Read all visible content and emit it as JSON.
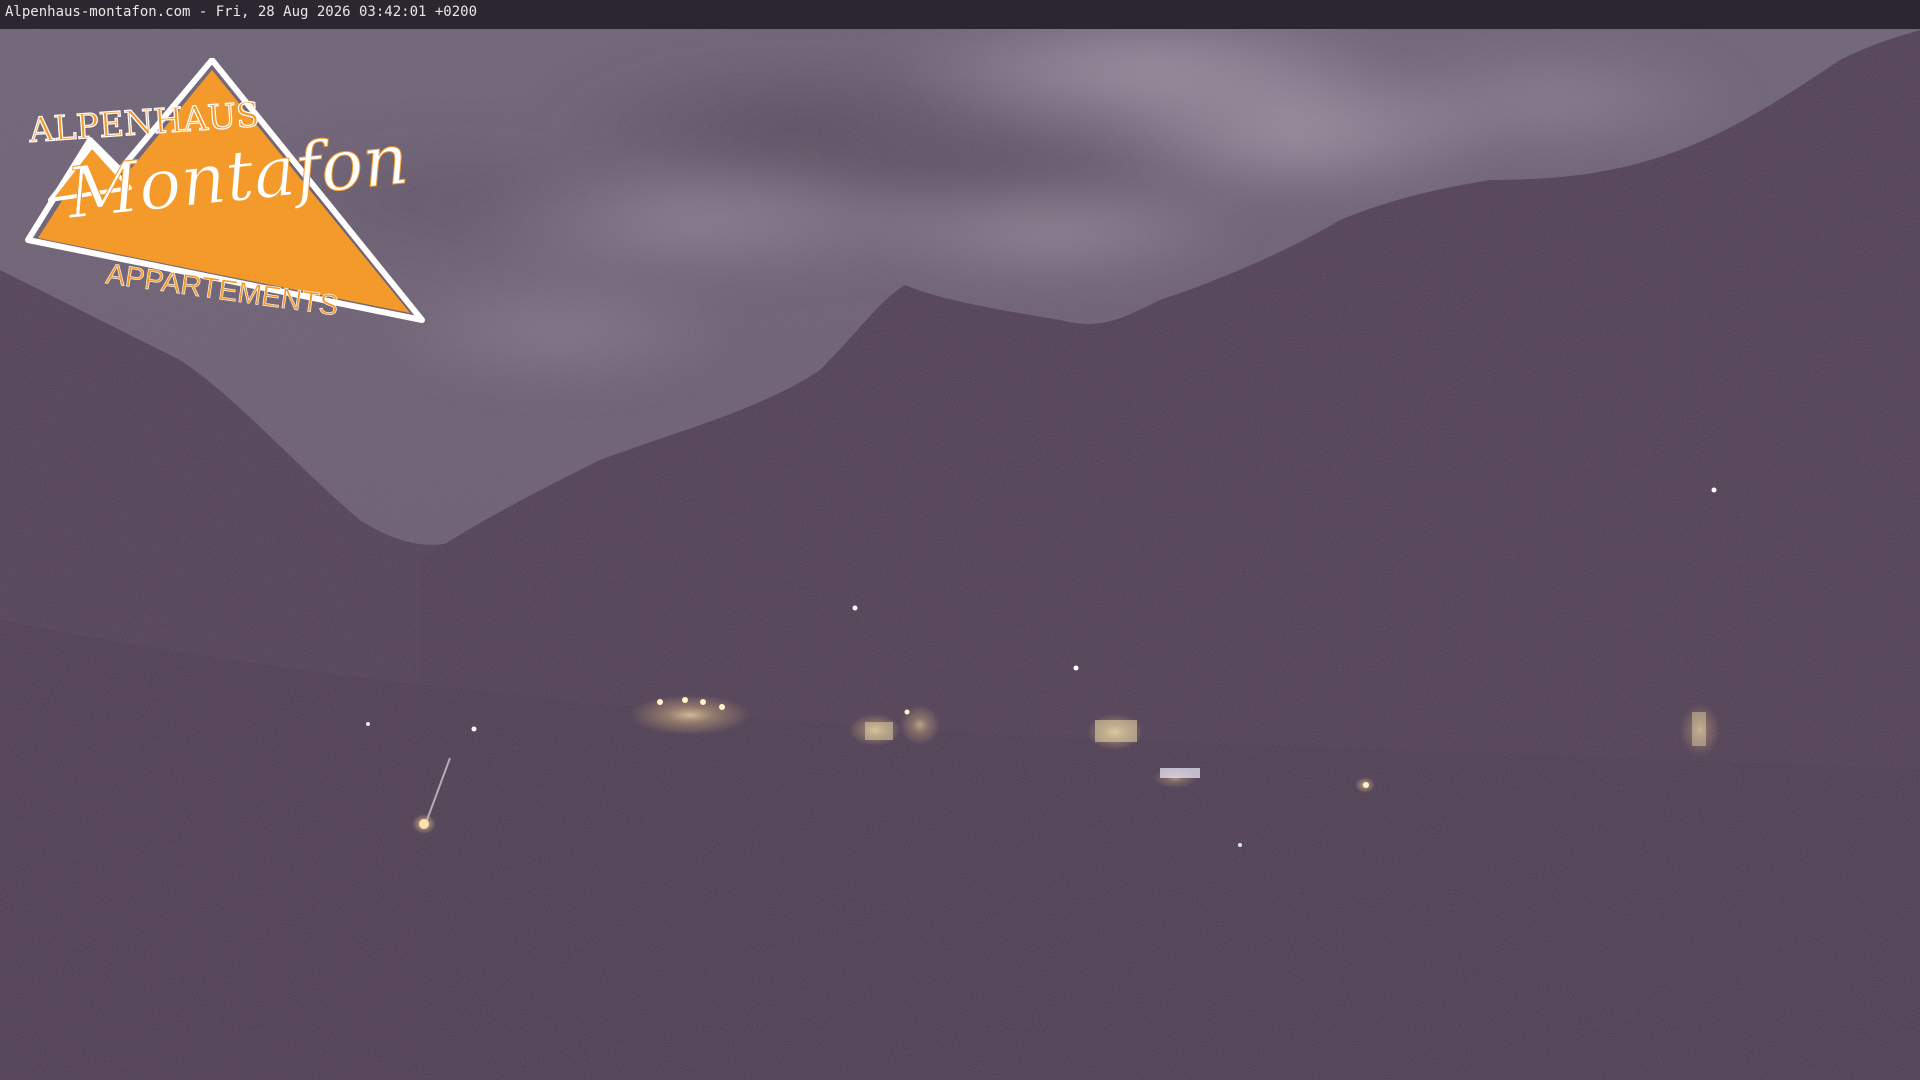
{
  "overlay": {
    "timestamp": "Alpenhaus-montafon.com - Fri, 28 Aug 2026 03:42:01 +0200"
  },
  "logo": {
    "line1": "ALPENHAUS",
    "line2": "Montafon",
    "line3": "APPARTEMENTS",
    "color": "#f39a2b"
  },
  "scene": {
    "description_colors": {
      "sky": "#6b5f73",
      "clouds": "#8f8696",
      "mountains": "#4e3d50",
      "valley_lights": "#f3d89a"
    }
  }
}
